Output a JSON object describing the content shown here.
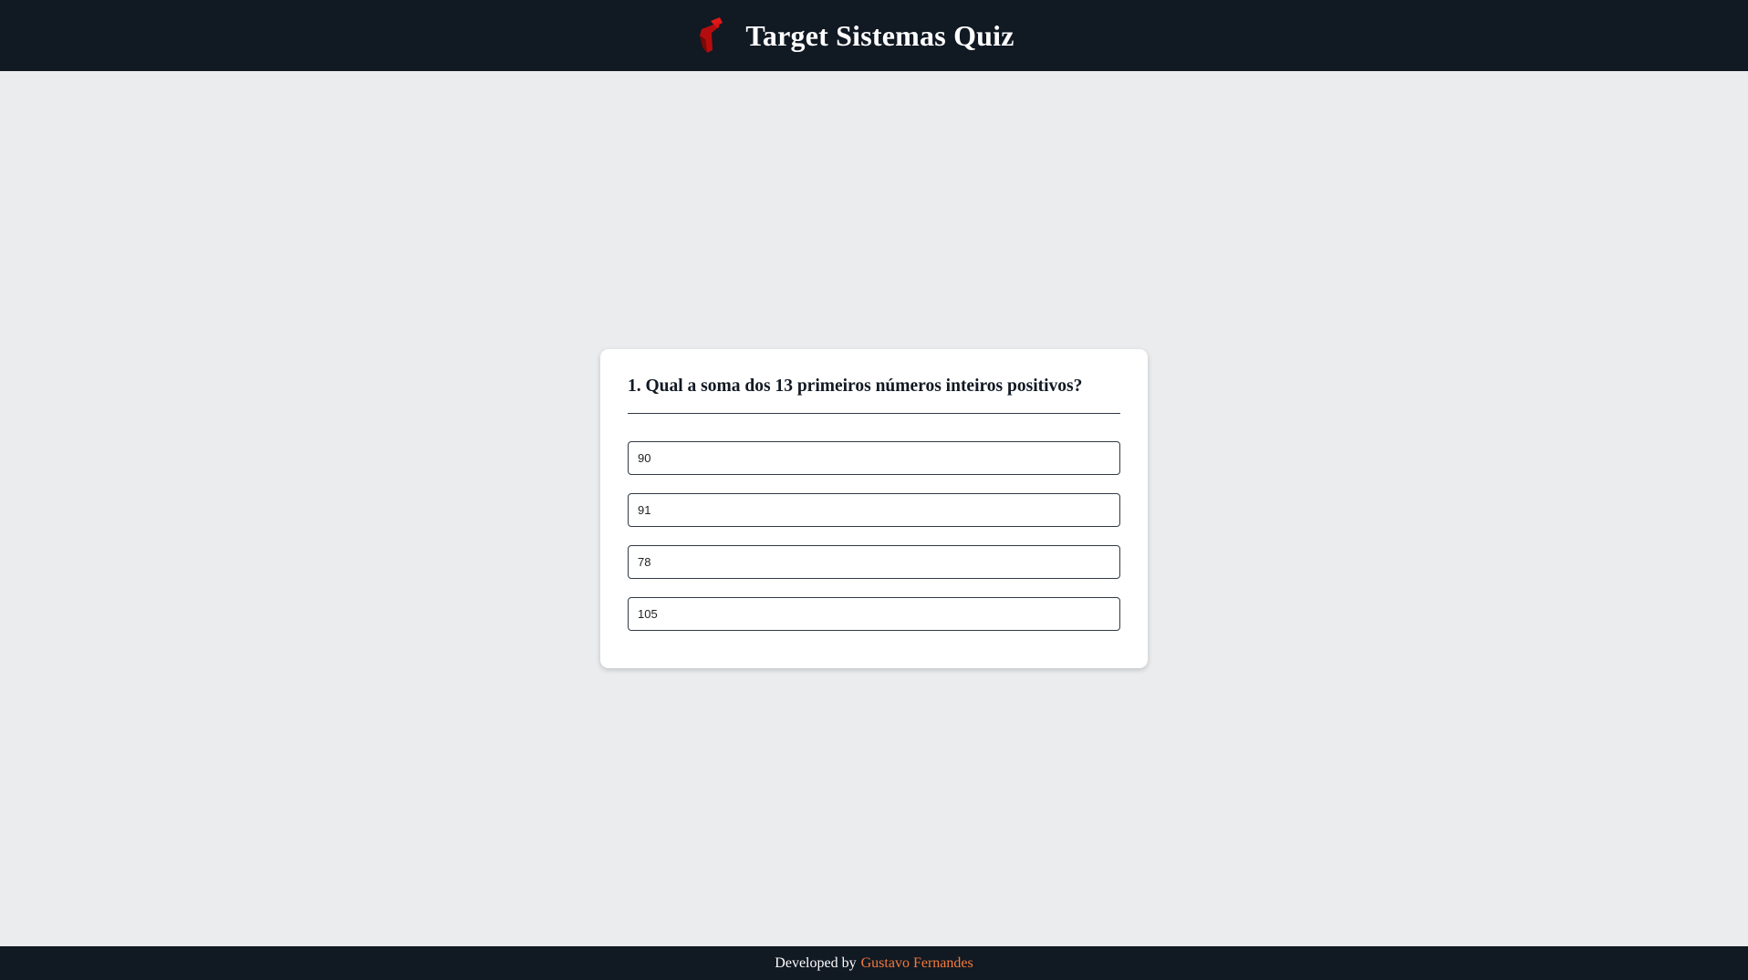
{
  "header": {
    "title": "Target Sistemas Quiz",
    "logo_icon": "target-logo-icon",
    "logo_color": "#cc1111",
    "background_color": "#111923"
  },
  "quiz": {
    "question": "1. Qual a soma dos 13 primeiros números inteiros positivos?",
    "options": [
      {
        "label": "90"
      },
      {
        "label": "91"
      },
      {
        "label": "78"
      },
      {
        "label": "105"
      }
    ]
  },
  "footer": {
    "prefix": "Developed by",
    "author": "Gustavo Fernandes",
    "author_color": "#f47a3a"
  }
}
